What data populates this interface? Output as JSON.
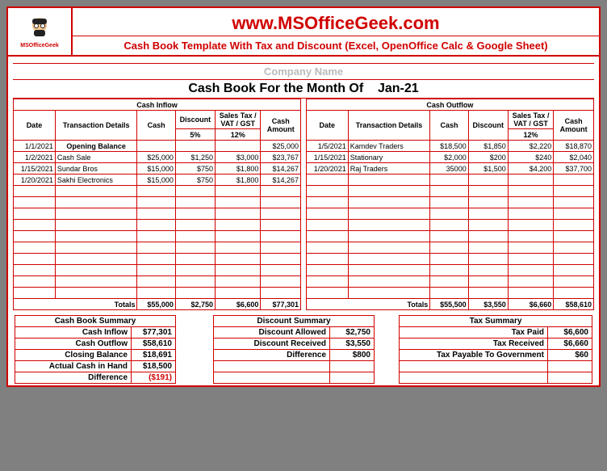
{
  "header": {
    "logo_label": "MSOfficeGeek",
    "site_title": "www.MSOfficeGeek.com",
    "sub_title": "Cash Book Template With Tax and Discount (Excel, OpenOffice Calc & Google Sheet)"
  },
  "company_name_placeholder": "Company Name",
  "month_label": "Cash Book For the Month Of",
  "month_value": "Jan-21",
  "inflow_title": "Cash Inflow",
  "outflow_title": "Cash Outflow",
  "columns": {
    "date": "Date",
    "details": "Transaction Details",
    "cash": "Cash",
    "discount": "Discount",
    "tax": "Sales Tax / VAT / GST",
    "amount": "Cash Amount"
  },
  "rates": {
    "inflow_discount": "5%",
    "inflow_tax": "12%",
    "outflow_tax": "12%"
  },
  "inflow_rows": [
    {
      "date": "1/1/2021",
      "details": "Opening Balance",
      "cash": "",
      "discount": "",
      "tax": "",
      "amount": "$25,000"
    },
    {
      "date": "1/2/2021",
      "details": "Cash Sale",
      "cash": "$25,000",
      "discount": "$1,250",
      "tax": "$3,000",
      "amount": "$23,767"
    },
    {
      "date": "1/15/2021",
      "details": "Sundar Bros",
      "cash": "$15,000",
      "discount": "$750",
      "tax": "$1,800",
      "amount": "$14,267"
    },
    {
      "date": "1/20/2021",
      "details": "Sakhi Electronics",
      "cash": "$15,000",
      "discount": "$750",
      "tax": "$1,800",
      "amount": "$14,267"
    }
  ],
  "outflow_rows": [
    {
      "date": "1/5/2021",
      "details": "Kamdev Traders",
      "cash": "$18,500",
      "discount": "$1,850",
      "tax": "$2,220",
      "amount": "$18,870"
    },
    {
      "date": "1/15/2021",
      "details": "Stationary",
      "cash": "$2,000",
      "discount": "$200",
      "tax": "$240",
      "amount": "$2,040"
    },
    {
      "date": "1/20/2021",
      "details": "Raj Traders",
      "cash": "35000",
      "discount": "$1,500",
      "tax": "$4,200",
      "amount": "$37,700"
    }
  ],
  "empty_row_count": 10,
  "totals": {
    "label": "Totals",
    "inflow": {
      "cash": "$55,000",
      "discount": "$2,750",
      "tax": "$6,600",
      "amount": "$77,301"
    },
    "outflow": {
      "cash": "$55,500",
      "discount": "$3,550",
      "tax": "$6,660",
      "amount": "$58,610"
    }
  },
  "summary": {
    "cashbook": {
      "title": "Cash Book Summary",
      "rows": [
        {
          "label": "Cash Inflow",
          "value": "$77,301"
        },
        {
          "label": "Cash Outflow",
          "value": "$58,610"
        },
        {
          "label": "Closing Balance",
          "value": "$18,691"
        },
        {
          "label": "Actual Cash in Hand",
          "value": "$18,500"
        },
        {
          "label": "Difference",
          "value": "($191)",
          "neg": true
        }
      ]
    },
    "discount": {
      "title": "Discount Summary",
      "rows": [
        {
          "label": "Discount Allowed",
          "value": "$2,750"
        },
        {
          "label": "Discount Received",
          "value": "$3,550"
        },
        {
          "label": "Difference",
          "value": "$800"
        }
      ]
    },
    "tax": {
      "title": "Tax Summary",
      "rows": [
        {
          "label": "Tax Paid",
          "value": "$6,600"
        },
        {
          "label": "Tax Received",
          "value": "$6,660"
        },
        {
          "label": "Tax Payable To Government",
          "value": "$60"
        }
      ]
    }
  }
}
